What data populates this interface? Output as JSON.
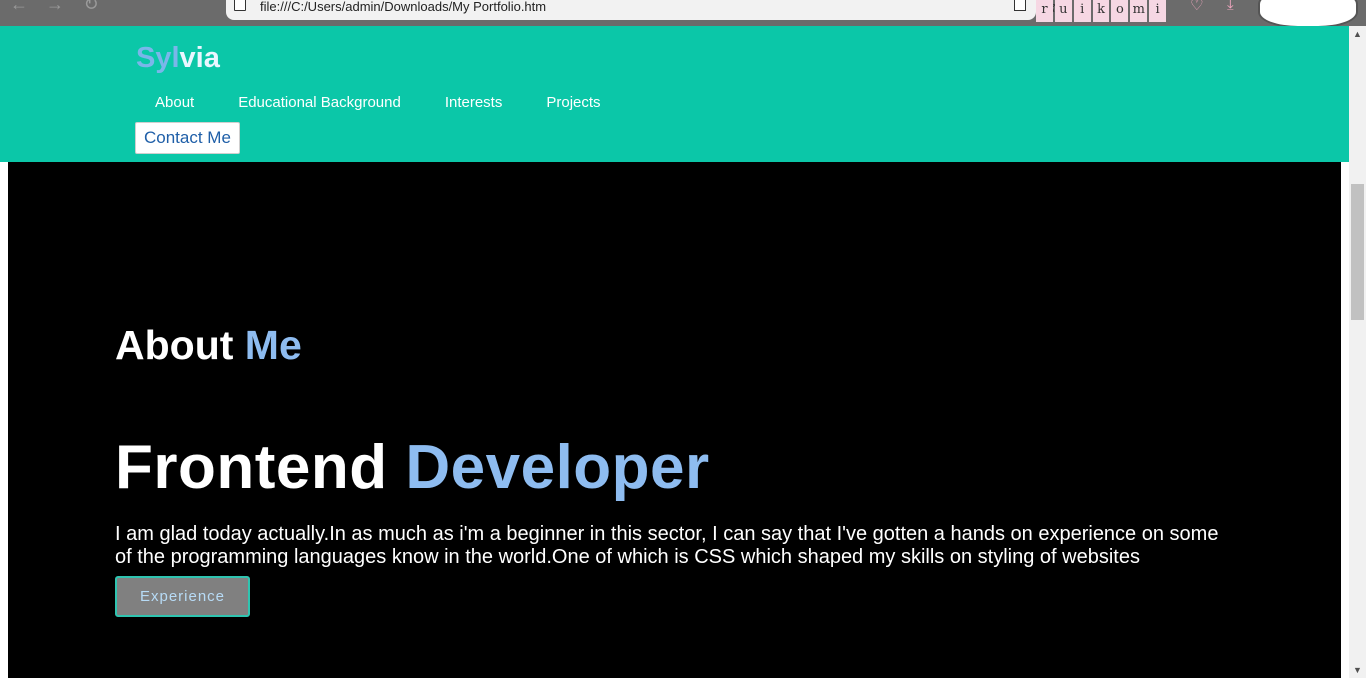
{
  "browser": {
    "back_icon": "←",
    "forward_icon": "→",
    "reload_icon": "↻",
    "url": "file:///C:/Users/admin/Downloads/My Portfolio.htm",
    "star_icon": "☆",
    "extension_letters": [
      "r",
      "u",
      "i",
      "k",
      "o",
      "m",
      "i"
    ],
    "pocket_icon": "♡",
    "download_icon": "⤓"
  },
  "header": {
    "logo_part1": "Syl",
    "logo_part2": "via",
    "nav": [
      "About",
      "Educational Background",
      "Interests",
      "Projects"
    ],
    "contact_button": "Contact Me"
  },
  "about": {
    "heading_white": "About ",
    "heading_accent": "Me",
    "role_white": "Frontend ",
    "role_accent": "Developer",
    "bio": "I am glad today actually.In as much as i'm a beginner in this sector, I can say that I've gotten a hands on experience on some of the programming languages know in the world.One of which is CSS which shaped my skills on styling of websites",
    "experience_button": "Experience"
  },
  "scrollbar": {
    "up_icon": "▲",
    "down_icon": "▼"
  },
  "colors": {
    "header_bg": "#0bc7a8",
    "accent_blue": "#8ebcf0",
    "content_bg": "#000000",
    "contact_text": "#1f5fa8"
  }
}
